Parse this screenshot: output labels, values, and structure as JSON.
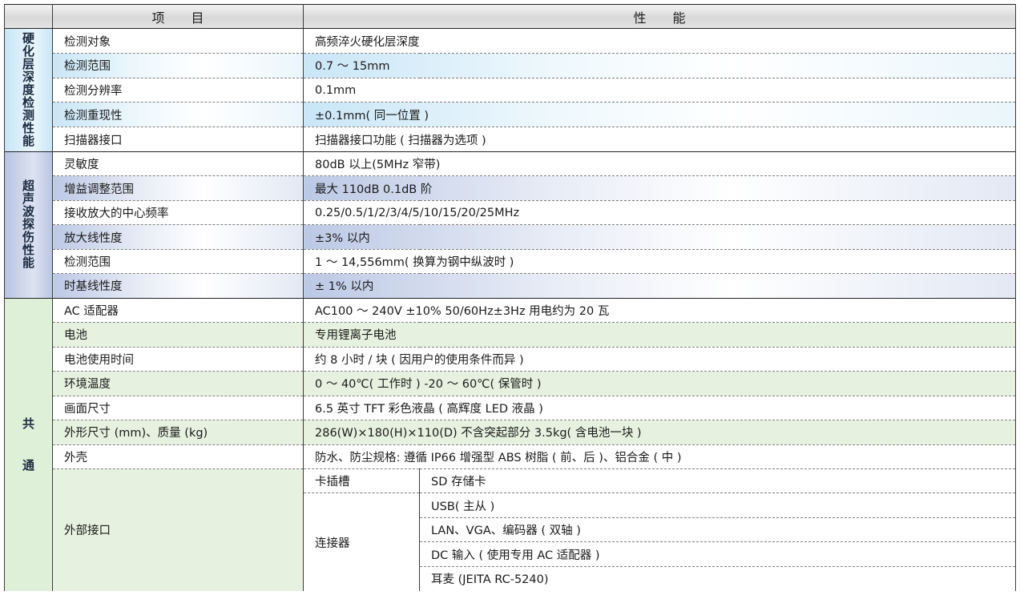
{
  "header": {
    "item": "项 目",
    "performance": "性 能"
  },
  "groups": {
    "hardening": {
      "label": "硬化层深度检测性能",
      "rows": [
        {
          "item": "检测对象",
          "value": "高频淬火硬化层深度"
        },
        {
          "item": "检测范围",
          "value": "0.7 ～ 15mm"
        },
        {
          "item": "检测分辨率",
          "value": "0.1mm"
        },
        {
          "item": "检测重现性",
          "value": "±0.1mm( 同一位置 )"
        },
        {
          "item": "扫描器接口",
          "value": "扫描器接口功能 ( 扫描器为选项 )"
        }
      ]
    },
    "ultrasonic": {
      "label": "超声波探伤性能",
      "rows": [
        {
          "item": "灵敏度",
          "value": "80dB 以上(5MHz 窄带)"
        },
        {
          "item": "增益调整范围",
          "value": "最大 110dB 0.1dB 阶"
        },
        {
          "item": "接收放大的中心频率",
          "value": "0.25/0.5/1/2/3/4/5/10/15/20/25MHz"
        },
        {
          "item": "放大线性度",
          "value": "±3% 以内"
        },
        {
          "item": "检测范围",
          "value": "1 ～ 14,556mm( 换算为钢中纵波时 )"
        },
        {
          "item": "时基线性度",
          "value": "± 1% 以内"
        }
      ]
    },
    "common": {
      "label": "共通",
      "rows": [
        {
          "item": "AC 适配器",
          "value": "AC100 ～ 240V ±10% 50/60Hz±3Hz 用电约为 20 瓦"
        },
        {
          "item": "电池",
          "value": "专用锂离子电池"
        },
        {
          "item": "电池使用时间",
          "value": "约 8 小时 / 块 ( 因用户的使用条件而异 )"
        },
        {
          "item": "环境温度",
          "value": "0 ～ 40℃( 工作时 ) -20 ～ 60℃( 保管时 )"
        },
        {
          "item": "画面尺寸",
          "value": "6.5 英寸 TFT 彩色液晶 ( 高辉度 LED 液晶 )"
        },
        {
          "item": "外形尺寸 (mm)、质量 (kg)",
          "value": "286(W)×180(H)×110(D) 不含突起部分 3.5kg( 含电池一块 )"
        },
        {
          "item": "外壳",
          "value": "防水、防尘规格: 遵循 IP66 增强型 ABS 树脂 ( 前、后 )、铝合金 ( 中 )"
        }
      ],
      "interface": {
        "item": "外部接口",
        "card_slot": {
          "label": "卡插槽",
          "value": "SD 存储卡"
        },
        "connector": {
          "label": "连接器",
          "values": [
            "USB( 主从 )",
            "LAN、VGA、编码器 ( 双轴 )",
            "DC 输入 ( 使用专用 AC 适配器 )",
            "耳麦 (JEITA RC-5240)"
          ]
        }
      }
    }
  }
}
